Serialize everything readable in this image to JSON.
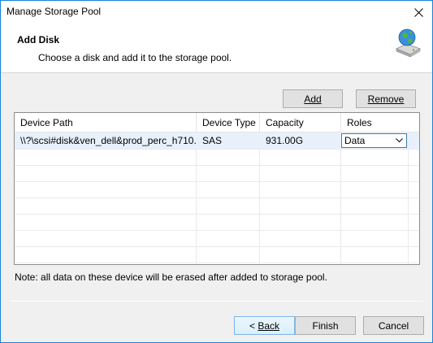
{
  "window": {
    "title": "Manage Storage Pool"
  },
  "header": {
    "title": "Add Disk",
    "description": "Choose a disk and add it to the storage pool."
  },
  "toolbar": {
    "add_label": "Add",
    "remove_label": "Remove"
  },
  "table": {
    "columns": [
      "Device Path",
      "Device Type",
      "Capacity",
      "Roles"
    ],
    "rows": [
      {
        "device_path": "\\\\?\\scsi#disk&ven_dell&prod_perc_h710...",
        "device_type": "SAS",
        "capacity": "931.00G",
        "role": "Data"
      }
    ]
  },
  "note": "Note: all data on these device will be erased after added to storage pool.",
  "footer": {
    "back_label": "Back",
    "finish_label": "Finish",
    "cancel_label": "Cancel"
  },
  "colors": {
    "accent": "#1883d7",
    "selection": "#e8f1fb",
    "button_hover": "#d9f0fc"
  }
}
